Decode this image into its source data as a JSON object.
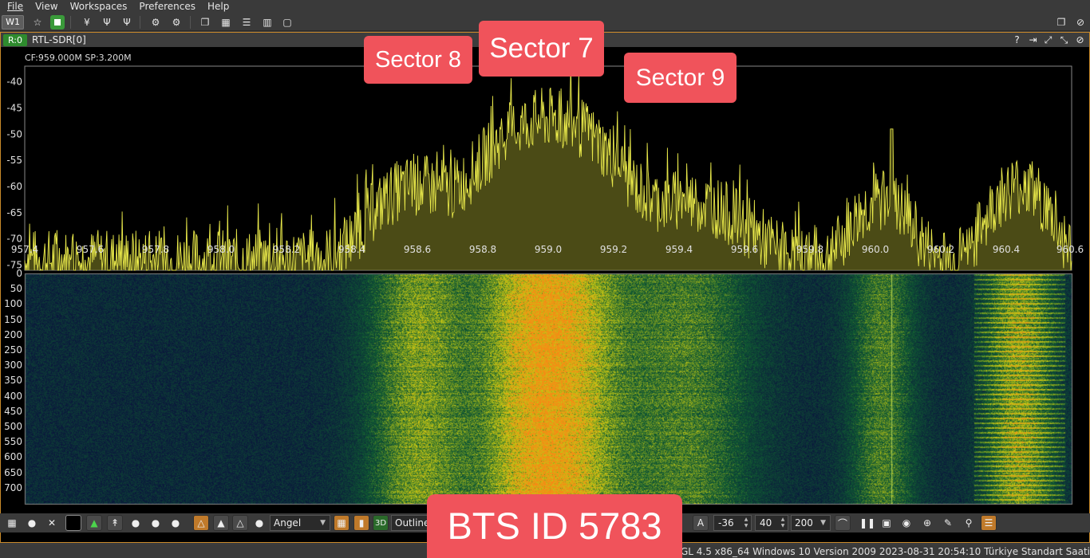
{
  "menu": [
    "File",
    "View",
    "Workspaces",
    "Preferences",
    "Help"
  ],
  "toolbar": {
    "workspace": "W1"
  },
  "panel": {
    "rx_tag": "R:0",
    "device": "RTL-SDR[0]",
    "spectrum_info": "CF:959.000M SP:3.200M"
  },
  "chart_data": {
    "type": "line",
    "x_axis": {
      "range": [
        957.4,
        960.6
      ],
      "ticks": [
        "957.4",
        "957.6",
        "957.8",
        "958.0",
        "958.2",
        "958.4",
        "958.6",
        "958.8",
        "959.0",
        "959.2",
        "959.4",
        "959.6",
        "959.8",
        "960.0",
        "960.2",
        "960.4",
        "960.6"
      ]
    },
    "y_axis": {
      "range": [
        -76,
        -37
      ],
      "ticks": [
        "-40",
        "-45",
        "-50",
        "-55",
        "-60",
        "-65",
        "-70",
        "-75"
      ]
    },
    "waterfall_axis": {
      "ticks": [
        "0",
        "50",
        "100",
        "150",
        "200",
        "250",
        "300",
        "350",
        "400",
        "450",
        "500",
        "550",
        "600",
        "650",
        "700"
      ]
    },
    "noise_floor": -74,
    "peaks": [
      {
        "center": 958.6,
        "width": 0.18,
        "level": -60
      },
      {
        "center": 959.0,
        "width": 0.22,
        "level": -47
      },
      {
        "center": 959.42,
        "width": 0.24,
        "level": -63
      },
      {
        "center": 960.02,
        "width": 0.12,
        "level": -63
      },
      {
        "center": 960.44,
        "width": 0.12,
        "level": -60
      }
    ],
    "spikes": [
      {
        "center": 960.05,
        "level": -49
      }
    ],
    "color": "#e8e84a",
    "grid": false
  },
  "bottombar": {
    "palette": "Angel",
    "render_mode": "Outline",
    "auto_label": "A",
    "level_min": "-36",
    "level_range": "40",
    "fps": "200"
  },
  "status": "2 OpenGL 4.5 x86_64 Windows 10 Version 2009  2023-08-31 20:54:10 Türkiye Standart Saati",
  "annotations": {
    "sector8": "Sector 8",
    "sector7": "Sector 7",
    "sector9": "Sector 9",
    "bts": "BTS ID 5783"
  }
}
